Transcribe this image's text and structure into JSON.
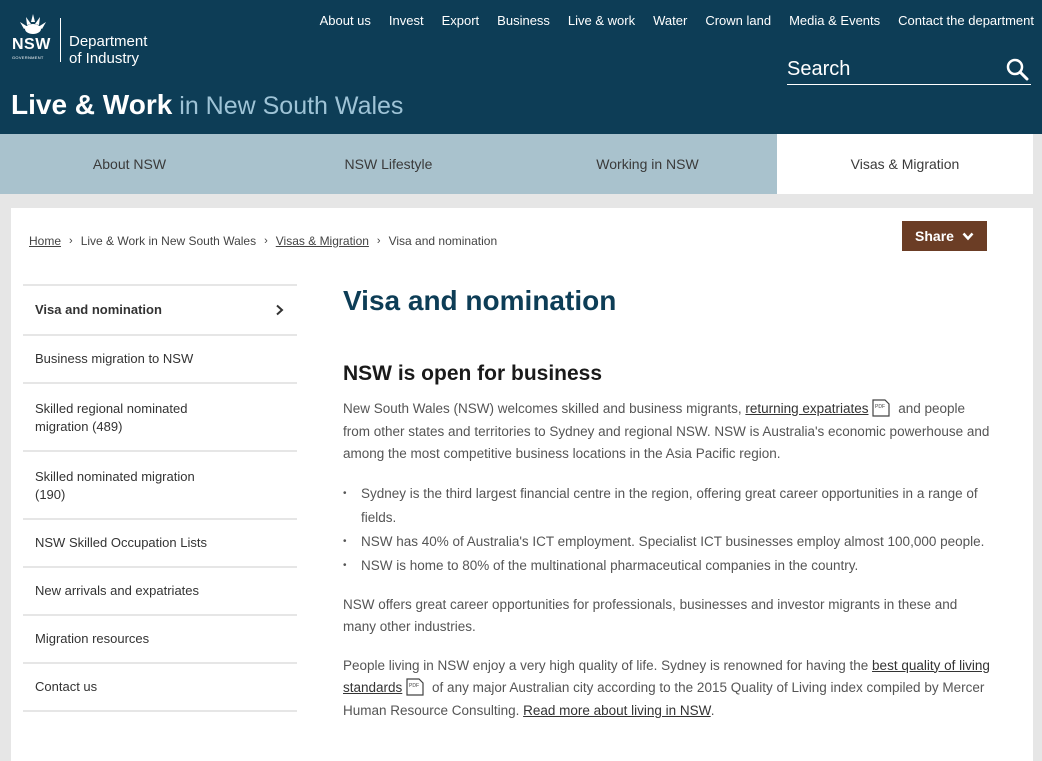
{
  "header": {
    "logo_nsw": "NSW",
    "logo_gov": "GOVERNMENT",
    "logo_dept_line1": "Department",
    "logo_dept_line2": "of Industry",
    "nav": [
      "About us",
      "Invest",
      "Export",
      "Business",
      "Live & work",
      "Water",
      "Crown land",
      "Media & Events",
      "Contact the department"
    ],
    "search_placeholder": "Search",
    "search_icon": "search-icon",
    "title_bold": "Live & Work",
    "title_light": " in New South Wales"
  },
  "main_nav": {
    "tabs": [
      "About NSW",
      "NSW Lifestyle",
      "Working in NSW",
      "Visas & Migration"
    ],
    "active": "Visas & Migration"
  },
  "breadcrumb": {
    "home": "Home",
    "live_work": "Live & Work in New South Wales",
    "visas": "Visas & Migration",
    "current": "Visa and nomination"
  },
  "share": {
    "label": "Share",
    "icon": "chevron-down-icon"
  },
  "sidenav": {
    "items": [
      "Visa and nomination",
      "Business migration to NSW",
      "Skilled regional nominated migration (489)",
      "Skilled nominated migration (190)",
      "NSW Skilled Occupation Lists",
      "New arrivals and expatriates",
      "Migration resources",
      "Contact us"
    ]
  },
  "content": {
    "h1": "Visa and nomination",
    "h2": "NSW is open for business",
    "p1_before": "New South Wales (NSW) welcomes skilled and business migrants, ",
    "p1_link": "returning expatriates",
    "p1_after": " and people from other states and territories to Sydney and regional NSW. NSW is Australia's economic powerhouse and among the most competitive business locations in the Asia Pacific region.",
    "bullets": [
      "Sydney is the third largest financial centre in the region, offering great career opportunities in a range of fields.",
      "NSW has 40% of Australia's ICT employment. Specialist ICT businesses employ almost 100,000 people.",
      "NSW is home to 80% of the multinational pharmaceutical companies in the country."
    ],
    "p2": "NSW offers great career opportunities for professionals, businesses and investor migrants in these and many other industries.",
    "p3_before": "People living in NSW enjoy a very high quality of life. Sydney is renowned for having the ",
    "p3_link": "best quality of living standards",
    "p3_middle": " of any major Australian city according to the 2015 Quality of Living index compiled by Mercer Human Resource Consulting. ",
    "p3_link2": "Read more about living in NSW",
    "p3_end": ".",
    "pdf_label": "PDF"
  },
  "colors": {
    "header_bg": "#0d3d56",
    "nav_bg": "#a9c2cd",
    "share_bg": "#6b3d25",
    "title_accent": "#9ec3d6"
  }
}
